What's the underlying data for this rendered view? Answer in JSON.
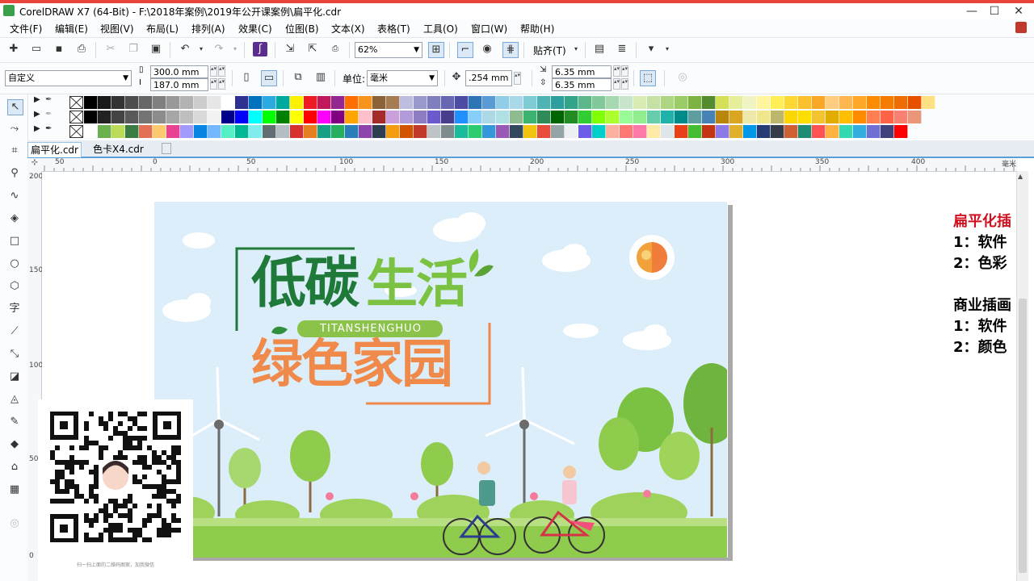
{
  "window": {
    "title": "CorelDRAW X7 (64-Bit) - F:\\2018年案例\\2019年公开课案例\\扁平化.cdr",
    "minimize": "—",
    "maximize": "☐",
    "close": "✕"
  },
  "menu": [
    "文件(F)",
    "编辑(E)",
    "视图(V)",
    "布局(L)",
    "排列(A)",
    "效果(C)",
    "位图(B)",
    "文本(X)",
    "表格(T)",
    "工具(O)",
    "窗口(W)",
    "帮助(H)"
  ],
  "toolbar": {
    "zoom": "62%",
    "snap": "贴齐(T)"
  },
  "propbar": {
    "preset": "自定义",
    "width": "300.0 mm",
    "height": "187.0 mm",
    "units_label": "单位:",
    "units": "毫米",
    "nudge": ".254 mm",
    "dup_x": "6.35 mm",
    "dup_y": "6.35 mm"
  },
  "tabs": [
    "扁平化.cdr",
    "色卡X4.cdr"
  ],
  "ruler": {
    "h": [
      "50",
      "0",
      "50",
      "100",
      "150",
      "200",
      "250",
      "300",
      "350",
      "400",
      "毫米"
    ],
    "v": [
      "200",
      "150",
      "100",
      "50",
      "0"
    ]
  },
  "artwork": {
    "headline1": "低碳",
    "headline2": "生活",
    "pinyin": "TITANSHENGHUO",
    "headline3": "绿色家园",
    "colors": {
      "sky": "#dceefa",
      "darkgreen": "#1f7a3a",
      "lightgreen": "#7cc242",
      "orange": "#f08a4b",
      "grass": "#8fcb4c"
    }
  },
  "qr_caption": "扫一扫上面的二维码图案，加我微信",
  "side_notes": [
    "扁平化插",
    "1：软件",
    "2：色彩",
    "",
    "商业插画",
    "1：软件",
    "2：颜色"
  ],
  "palette": {
    "row1": [
      "#000000",
      "#1a1a1a",
      "#333333",
      "#4d4d4d",
      "#666666",
      "#808080",
      "#999999",
      "#b3b3b3",
      "#cccccc",
      "#e6e6e6",
      "#ffffff",
      "#2e3192",
      "#0071bc",
      "#29abe2",
      "#00a99d",
      "#fff200",
      "#ed1c24",
      "#c2185b",
      "#92278f",
      "#ff6f00",
      "#f7941d",
      "#8c6239",
      "#a67c52",
      "#bdbde0",
      "#9999cc",
      "#7f7fbf",
      "#6666b2",
      "#4c4ca5",
      "#2e75b6",
      "#5b9bd5",
      "#92cde8",
      "#a9d9e8",
      "#7ecbd3",
      "#4fb3b3",
      "#2e9e9e",
      "#33a38a",
      "#5cb88a",
      "#82c99a",
      "#a6d9b0",
      "#c8e6c9",
      "#d8ecb4",
      "#c5e1a5",
      "#aed581",
      "#9ccc65",
      "#7cb342",
      "#558b2f",
      "#d4e157",
      "#e6ee9c",
      "#f0f4c3",
      "#fff59d",
      "#ffee58",
      "#fdd835",
      "#fbc02d",
      "#f9a825",
      "#ffcc80",
      "#ffb74d",
      "#ffa726",
      "#fb8c00",
      "#f57c00",
      "#ef6c00",
      "#e65100",
      "#ffe082"
    ],
    "row2": [
      "#000000",
      "#222222",
      "#444444",
      "#595959",
      "#737373",
      "#8c8c8c",
      "#a6a6a6",
      "#bfbfbf",
      "#d9d9d9",
      "#f2f2f2",
      "#00008b",
      "#0000ff",
      "#00ffff",
      "#00ff00",
      "#008000",
      "#ffff00",
      "#ff0000",
      "#ff00ff",
      "#800080",
      "#ffa500",
      "#ffc0cb",
      "#a52a2a",
      "#c9a0dc",
      "#b19cd9",
      "#8e7cc3",
      "#6a5acd",
      "#483d8b",
      "#1e90ff",
      "#87cefa",
      "#add8e6",
      "#b0e0e6",
      "#8fbc8f",
      "#3cb371",
      "#2e8b57",
      "#006400",
      "#228b22",
      "#32cd32",
      "#7fff00",
      "#adff2f",
      "#98fb98",
      "#90ee90",
      "#66cdaa",
      "#20b2aa",
      "#008b8b",
      "#5f9ea0",
      "#4682b4",
      "#b8860b",
      "#daa520",
      "#eee8aa",
      "#f0e68c",
      "#bdb76b",
      "#ffd700",
      "#ffdf00",
      "#f4c430",
      "#e1ad01",
      "#ffbf00",
      "#ff8c00",
      "#ff7f50",
      "#ff6347",
      "#fa8072",
      "#e9967a"
    ],
    "row3": [
      "#ffffff",
      "#6ab04c",
      "#badc58",
      "#3a7d44",
      "#e17055",
      "#fdcb6e",
      "#e84393",
      "#a29bfe",
      "#0984e3",
      "#74b9ff",
      "#55efc4",
      "#00b894",
      "#81ecec",
      "#636e72",
      "#b2bec3",
      "#d63031",
      "#e67e22",
      "#16a085",
      "#27ae60",
      "#2980b9",
      "#8e44ad",
      "#2c3e50",
      "#f39c12",
      "#d35400",
      "#c0392b",
      "#bdc3c7",
      "#7f8c8d",
      "#1abc9c",
      "#2ecc71",
      "#3498db",
      "#9b59b6",
      "#34495e",
      "#f1c40f",
      "#e74c3c",
      "#95a5a6",
      "#ecf0f1",
      "#6c5ce7",
      "#00cec9",
      "#fab1a0",
      "#ff7675",
      "#fd79a8",
      "#ffeaa7",
      "#dfe6e9",
      "#e84118",
      "#44bd32",
      "#c23616",
      "#8c7ae6",
      "#e1b12c",
      "#0097e6",
      "#273c75",
      "#353b48",
      "#cd6133",
      "#218c74",
      "#ff5252",
      "#ffb142",
      "#33d9b2",
      "#34ace0",
      "#706fd3",
      "#40407a",
      "#ff0000"
    ]
  }
}
